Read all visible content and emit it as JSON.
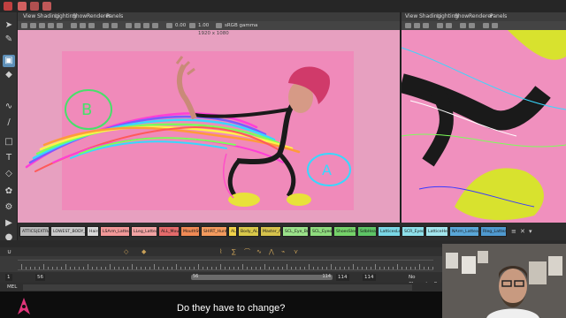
{
  "viewport_left": {
    "menu": [
      "View",
      "Shading",
      "Lighting",
      "Show",
      "Renderer",
      "Panels"
    ],
    "toolbar_values": {
      "exposure": "0.00",
      "gamma": "1.00",
      "color_space": "sRGB gamma"
    },
    "resolution_label": "1920 x 1080",
    "annotations": {
      "b": "B",
      "a": "A"
    }
  },
  "viewport_right": {
    "menu": [
      "View",
      "Shading",
      "Lighting",
      "Show",
      "Renderer",
      "Panels"
    ]
  },
  "selection_sets": [
    {
      "label": "ATTICS|EXTRA",
      "color": "#b9b9b9"
    },
    {
      "label": "LOWEST_BODY_ALL",
      "color": "#c9c9c9"
    },
    {
      "label": "Hairs",
      "color": "#d9d9d9"
    },
    {
      "label": "LSArm_Latteas",
      "color": "#f29999"
    },
    {
      "label": "LLeg_Latteas",
      "color": "#f2a3a3"
    },
    {
      "label": "ALL_Mouth",
      "color": "#e46b6b"
    },
    {
      "label": "MouthSQ",
      "color": "#f08a55"
    },
    {
      "label": "SHIRT_Hunt",
      "color": "#f49b5e"
    },
    {
      "label": "ALL",
      "color": "#f2d34a"
    },
    {
      "label": "Body_ALL",
      "color": "#d9c84a"
    },
    {
      "label": "Master_All",
      "color": "#d6c24c"
    },
    {
      "label": "SCL_Eye_Brow",
      "color": "#9be28a"
    },
    {
      "label": "SCL_Eyeonly",
      "color": "#8fdc7e"
    },
    {
      "label": "ShoesSleeves",
      "color": "#76d36a"
    },
    {
      "label": "SdbHead",
      "color": "#5ec566"
    },
    {
      "label": "LatticesLeg",
      "color": "#7ad8e6"
    },
    {
      "label": "SCR_Eyeoth",
      "color": "#8ee0ea"
    },
    {
      "label": "LatticeHead",
      "color": "#a3e6ee"
    },
    {
      "label": "NArm_Latteas",
      "color": "#5aa7d8"
    },
    {
      "label": "Rleg_Latteas",
      "color": "#4f99cf"
    }
  ],
  "timeline": {
    "range_start": "1",
    "playback_start": "56",
    "current_frame": "56",
    "playback_end": "114",
    "range_end": "114",
    "total_end": "114",
    "character_set": "No Character Se"
  },
  "command_line": {
    "label": "MEL"
  },
  "subtitle": "Do they have to change?",
  "colors": {
    "accent": "#5d8fb8",
    "viewport_bg": "#f08aba",
    "subtitle": "#ffffff"
  }
}
